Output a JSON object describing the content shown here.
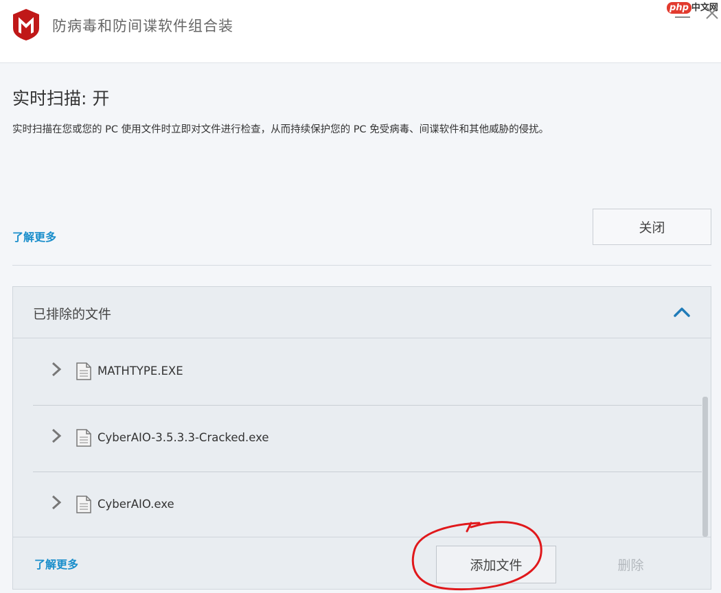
{
  "window": {
    "title": "防病毒和防间谍软件组合装",
    "brand_color": "#c01818",
    "badge": {
      "part1": "php",
      "part2": "中文网"
    }
  },
  "section": {
    "title": "实时扫描: 开",
    "description": "实时扫描在您或您的 PC 使用文件时立即对文件进行检查，从而持续保护您的 PC 免受病毒、间谍软件和其他威胁的侵扰。",
    "learn_more": "了解更多",
    "close_label": "关闭"
  },
  "excluded": {
    "title": "已排除的文件",
    "files": [
      {
        "name": "MATHTYPE.EXE",
        "icon": "file-icon"
      },
      {
        "name": "CyberAIO-3.5.3.3-Cracked.exe",
        "icon": "file-icon"
      },
      {
        "name": "CyberAIO.exe",
        "icon": "file-icon"
      }
    ],
    "learn_more": "了解更多",
    "add_label": "添加文件",
    "delete_label": "删除"
  },
  "colors": {
    "link": "#1a8ecb",
    "annotation": "#e0181b"
  }
}
